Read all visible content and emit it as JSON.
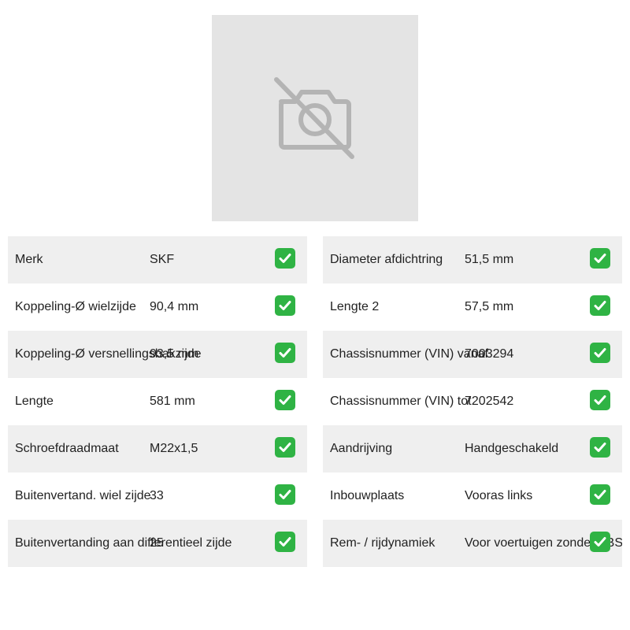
{
  "image": {
    "icon": "camera-off-icon",
    "background": "#e4e4e4"
  },
  "check_icon": "check-icon",
  "check_color": "#2fb344",
  "left": [
    {
      "label": "Merk",
      "value": "SKF"
    },
    {
      "label": "Koppeling-Ø wielzijde",
      "value": "90,4 mm"
    },
    {
      "label": "Koppeling-Ø versnellingsbakzijde",
      "value": "93,5 mm"
    },
    {
      "label": "Lengte",
      "value": "581 mm"
    },
    {
      "label": "Schroefdraadmaat",
      "value": "M22x1,5"
    },
    {
      "label": "Buitenvertand. wiel zijde",
      "value": "33"
    },
    {
      "label": "Buitenvertanding aan differentieel zijde",
      "value": "25"
    }
  ],
  "right": [
    {
      "label": "Diameter afdichtring",
      "value": "51,5 mm"
    },
    {
      "label": "Lengte 2",
      "value": "57,5 mm"
    },
    {
      "label": "Chassisnummer (VIN) vanaf",
      "value": "7003294"
    },
    {
      "label": "Chassisnummer (VIN) tot",
      "value": "7202542"
    },
    {
      "label": "Aandrijving",
      "value": "Handgeschakeld"
    },
    {
      "label": "Inbouwplaats",
      "value": "Vooras links"
    },
    {
      "label": "Rem- / rijdynamiek",
      "value": "Voor voertuigen zonder ABS"
    }
  ]
}
